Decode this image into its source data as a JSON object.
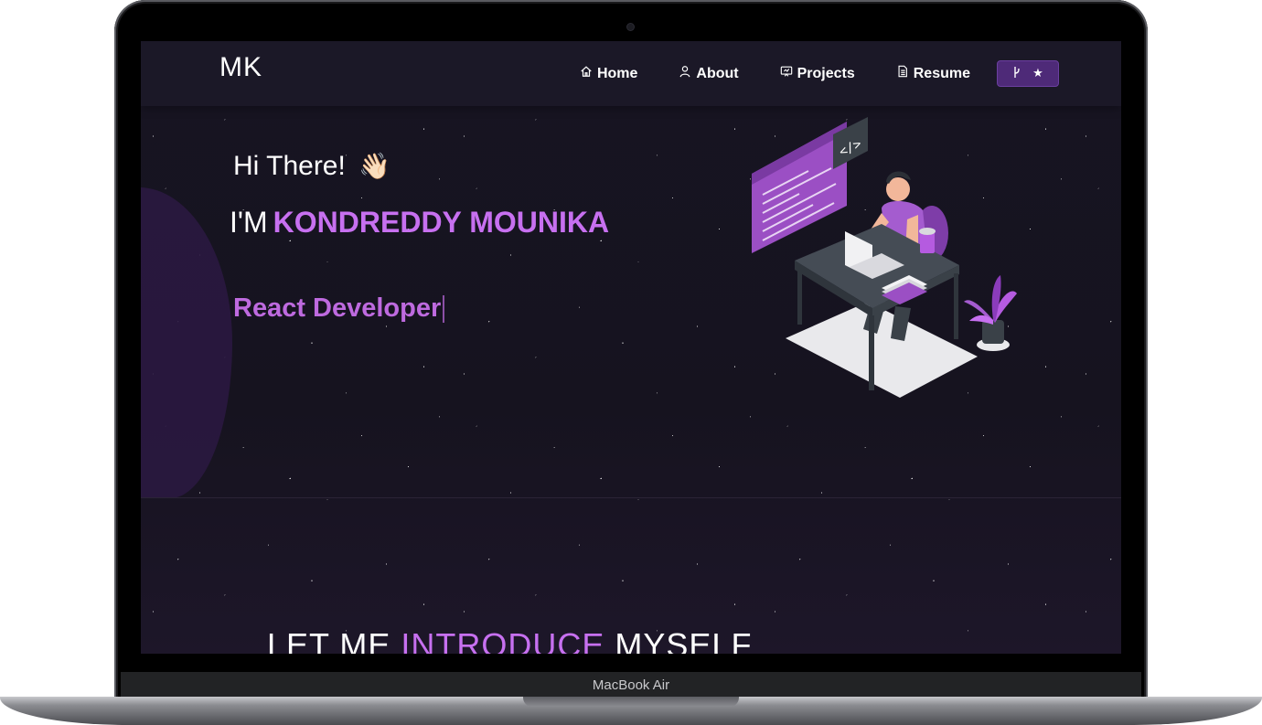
{
  "device": {
    "label": "MacBook Air"
  },
  "nav": {
    "logo": "MK",
    "items": [
      {
        "label": "Home",
        "icon": "home-icon"
      },
      {
        "label": "About",
        "icon": "user-icon"
      },
      {
        "label": "Projects",
        "icon": "projects-icon"
      },
      {
        "label": "Resume",
        "icon": "document-icon"
      }
    ],
    "fork_star": {
      "icons": [
        "git-fork-icon",
        "star-icon"
      ]
    }
  },
  "hero": {
    "greeting": "Hi There!",
    "wave": "👋🏻",
    "intro_prefix": "I'M",
    "name": "KONDREDDY MOUNIKA",
    "role": "React Developer"
  },
  "about": {
    "heading_prefix": "LET ME",
    "heading_highlight": "INTRODUCE",
    "heading_suffix": "MYSELF"
  },
  "colors": {
    "accent": "#c770f0",
    "background": "#171422",
    "button": "#4e2a78"
  }
}
